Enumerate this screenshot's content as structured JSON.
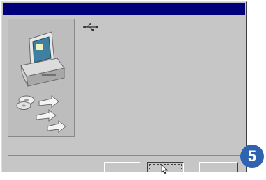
{
  "window": {
    "title": ""
  },
  "device": {
    "icon": "usb-icon",
    "name": ""
  },
  "message": {
    "status": ""
  },
  "buttons": {
    "back_label": "",
    "next_label": "",
    "cancel_label": ""
  },
  "step_badge": {
    "number": "5",
    "color": "#2e63b0"
  },
  "colors": {
    "titlebar": "#00007b",
    "dialog_face": "#c6c6c6"
  }
}
